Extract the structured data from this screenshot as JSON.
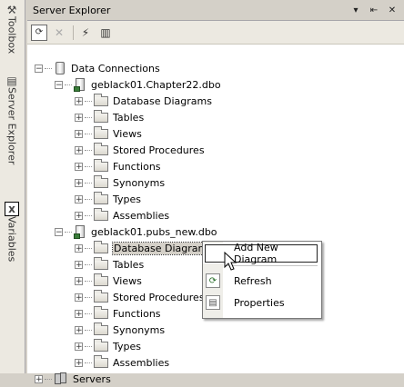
{
  "window": {
    "title": "Server Explorer",
    "dropdown_glyph": "▾",
    "pin_glyph": "⇤",
    "close_glyph": "✕"
  },
  "dock_tabs": [
    {
      "label": "Toolbox",
      "icon": "toolbox-icon",
      "glyph": "⚒"
    },
    {
      "label": "Server Explorer",
      "icon": "server-explorer-icon",
      "glyph": "▤"
    },
    {
      "label": "Variables",
      "icon": "variables-icon",
      "glyph": "x"
    }
  ],
  "toolbar": {
    "refresh": {
      "icon": "refresh-icon",
      "glyph": "⟳"
    },
    "stop": {
      "icon": "stop-refresh-icon",
      "glyph": "✕"
    },
    "connect_db": {
      "icon": "connect-to-database-icon",
      "glyph": "⚡"
    },
    "connect_server": {
      "icon": "connect-to-server-icon",
      "glyph": "▥"
    }
  },
  "tree": {
    "root": "Data Connections",
    "connections": [
      {
        "name": "geblack01.Chapter22.dbo",
        "children": [
          "Database Diagrams",
          "Tables",
          "Views",
          "Stored Procedures",
          "Functions",
          "Synonyms",
          "Types",
          "Assemblies"
        ]
      },
      {
        "name": "geblack01.pubs_new.dbo",
        "children": [
          "Database Diagrams",
          "Tables",
          "Views",
          "Stored Procedures",
          "Functions",
          "Synonyms",
          "Types",
          "Assemblies"
        ]
      }
    ],
    "servers": "Servers",
    "expander_plus": "+",
    "expander_minus": "−"
  },
  "context_menu": {
    "items": [
      {
        "label": "Add New Diagram",
        "icon": ""
      },
      {
        "label": "Refresh",
        "icon": "refresh-icon"
      },
      {
        "label": "Properties",
        "icon": "properties-icon"
      }
    ]
  }
}
